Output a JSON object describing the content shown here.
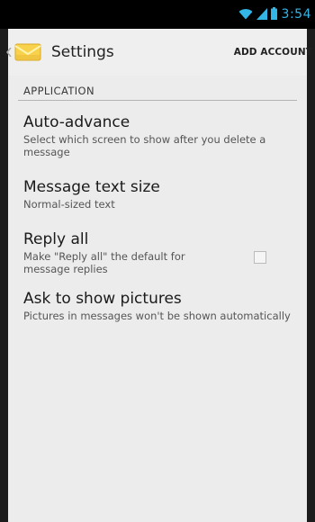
{
  "status_bar": {
    "time": "3:54",
    "icons": [
      "wifi-icon",
      "signal-icon",
      "battery-icon"
    ],
    "accent_color": "#33b5e5"
  },
  "action_bar": {
    "title": "Settings",
    "action_label": "ADD ACCOUNT",
    "app_icon": "email-envelope-icon",
    "up_icon": "up-caret-icon"
  },
  "section": {
    "header": "APPLICATION"
  },
  "preferences": [
    {
      "title": "Auto-advance",
      "summary": "Select which screen to show after you delete a message"
    },
    {
      "title": "Message text size",
      "summary": "Normal-sized text"
    },
    {
      "title": "Reply all",
      "summary": "Make \"Reply all\" the default for message replies",
      "checked": false
    },
    {
      "title": "Ask to show pictures",
      "summary": "Pictures in messages won't be shown automatically"
    }
  ]
}
